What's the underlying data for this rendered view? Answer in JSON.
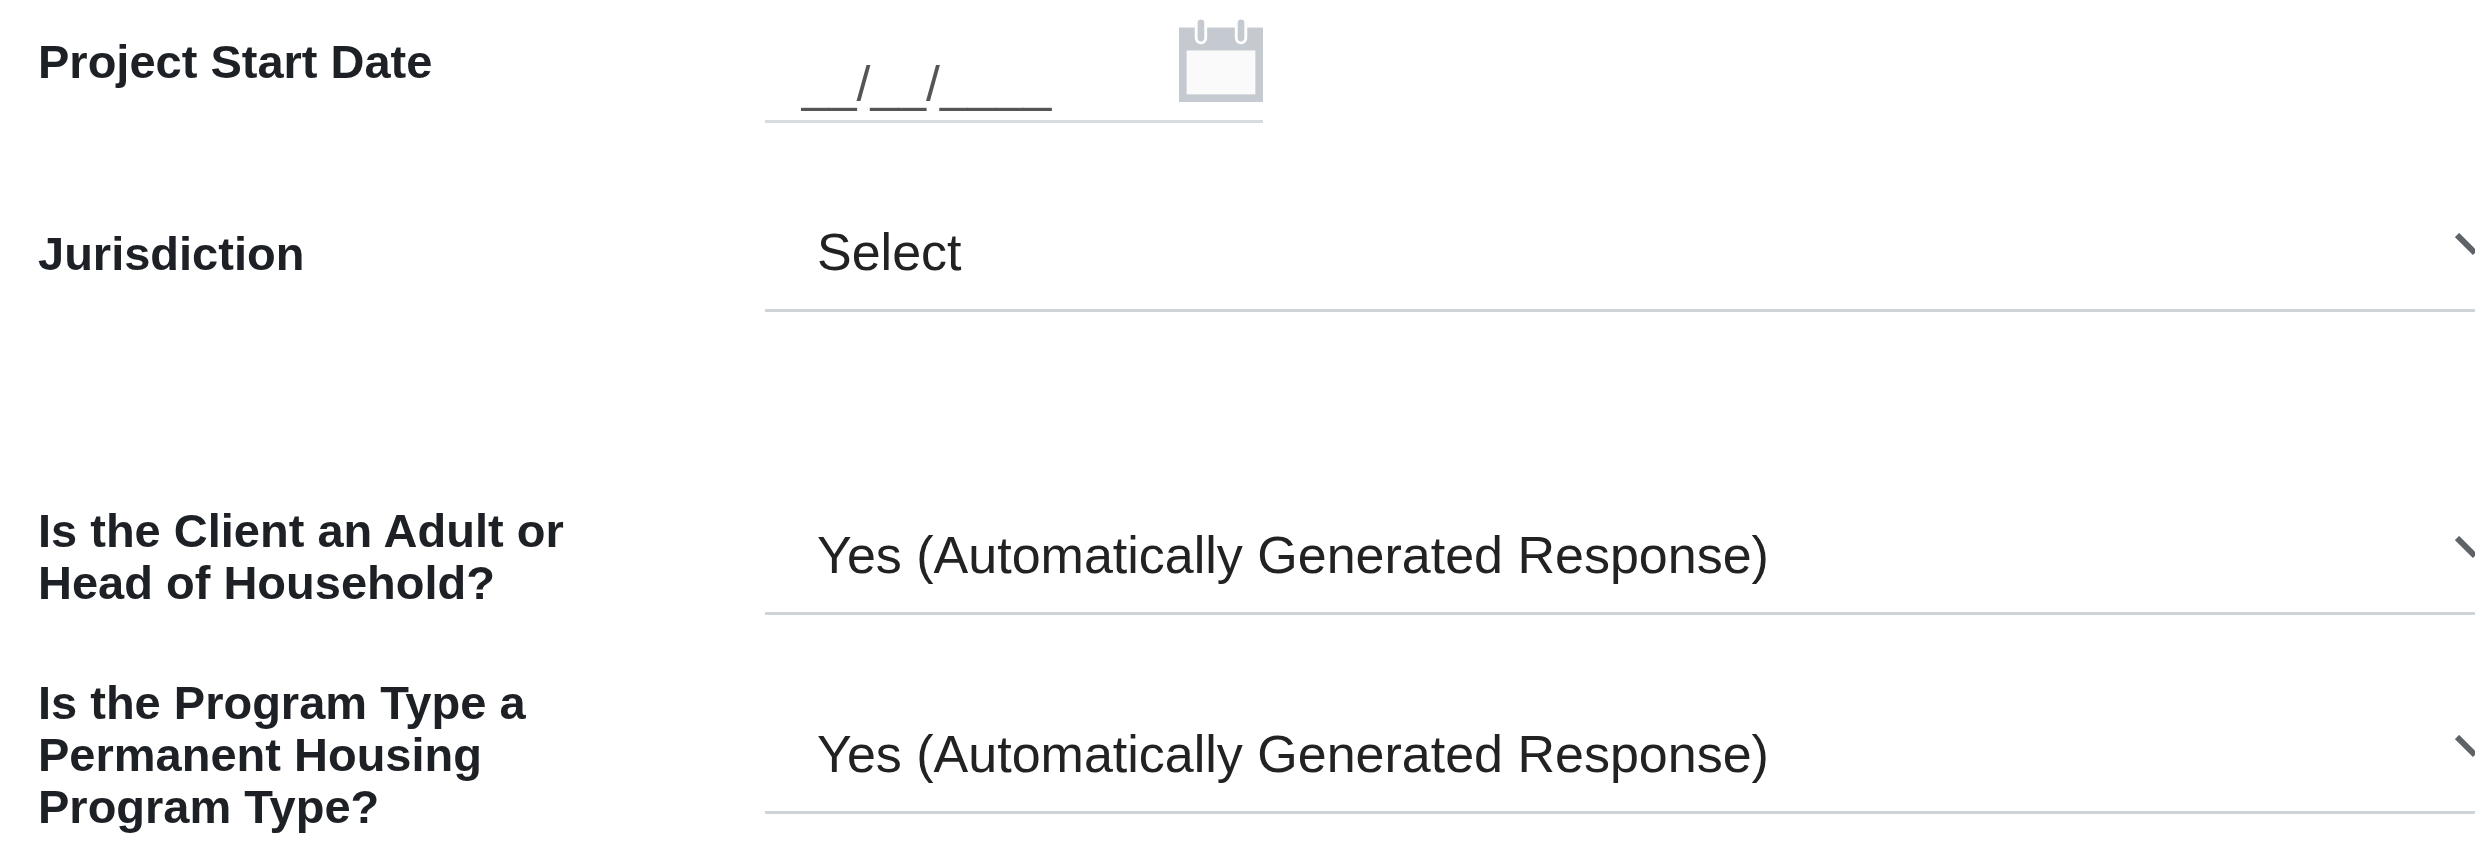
{
  "fields": [
    {
      "kind": "date",
      "label": "Project Start Date",
      "placeholder": "__/__/____"
    },
    {
      "kind": "select",
      "label": "Jurisdiction",
      "value": "Select"
    },
    {
      "kind": "select",
      "label": "Is the Client an Adult or Head of Household?",
      "value": "Yes (Automatically Generated Response)"
    },
    {
      "kind": "select",
      "label": "Is the Program Type a Permanent Housing Program Type?",
      "value": "Yes (Automatically Generated Response)"
    }
  ]
}
